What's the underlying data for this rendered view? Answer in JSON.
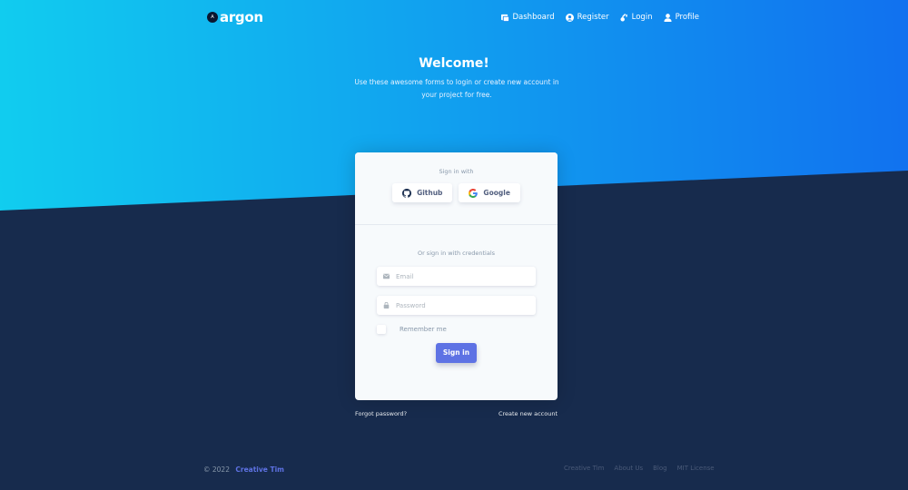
{
  "brand": {
    "name": "argon"
  },
  "nav": [
    {
      "label": "Dashboard",
      "icon": "dashboard-icon"
    },
    {
      "label": "Register",
      "icon": "user-circle-icon"
    },
    {
      "label": "Login",
      "icon": "key-icon"
    },
    {
      "label": "Profile",
      "icon": "profile-icon"
    }
  ],
  "hero": {
    "title": "Welcome!",
    "subtitle": "Use these awesome forms to login or create new account in your project for free."
  },
  "card": {
    "signin_with": "Sign in with",
    "github_label": "Github",
    "google_label": "Google",
    "credentials_label": "Or sign in with credentials",
    "email_placeholder": "Email",
    "password_placeholder": "Password",
    "remember_label": "Remember me",
    "signin_button": "Sign in"
  },
  "links": {
    "forgot": "Forgot password?",
    "create": "Create new account"
  },
  "footer": {
    "copyright": "© 2022",
    "company": "Creative Tim",
    "links": [
      "Creative Tim",
      "About Us",
      "Blog",
      "MIT License"
    ]
  },
  "colors": {
    "accent": "#5e72e4",
    "hero_start": "#11cdef",
    "hero_end": "#1171ef",
    "background": "#172b4d"
  }
}
